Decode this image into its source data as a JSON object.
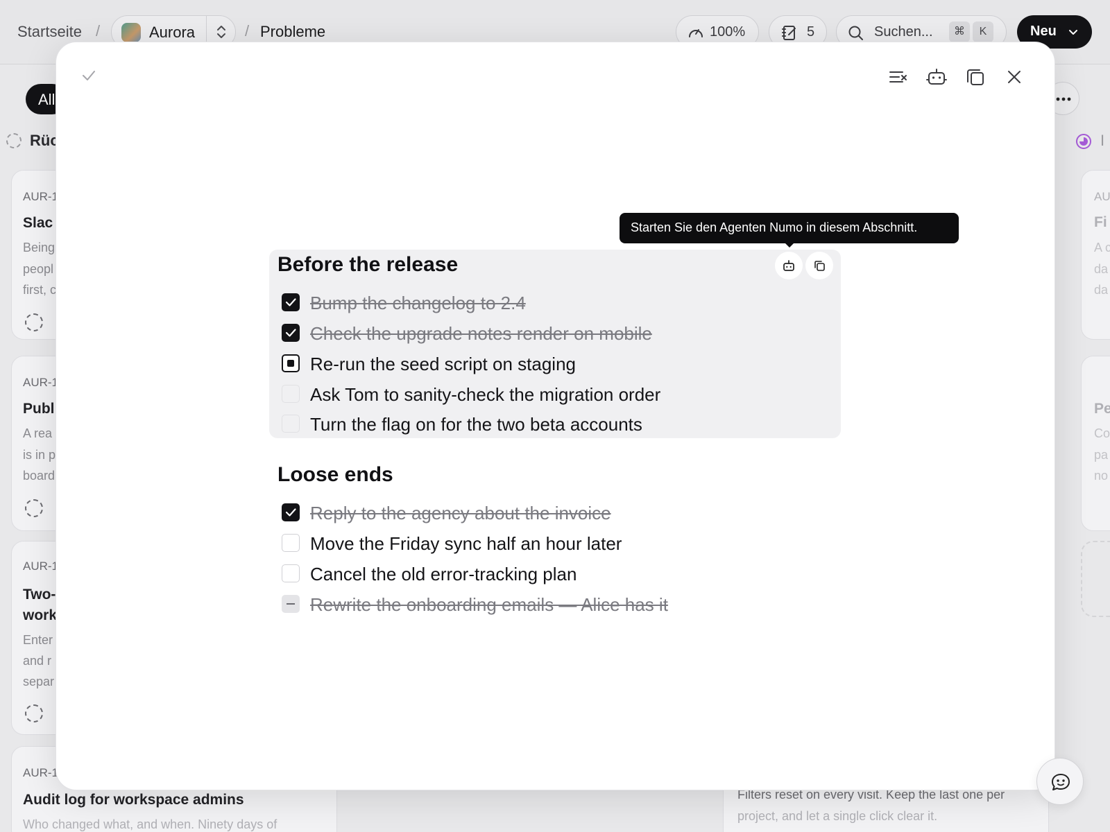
{
  "breadcrumb": {
    "home": "Startseite",
    "project": "Aurora",
    "page": "Probleme"
  },
  "header": {
    "zoom": "100%",
    "notes_count": "5",
    "search_placeholder": "Suchen...",
    "search_kbd_mod": "⌘",
    "search_kbd_key": "K",
    "new_label": "Neu"
  },
  "board": {
    "filter_all": "All",
    "column_title": "Rüc",
    "cards": [
      {
        "id": "AUR-1",
        "title": "Slac",
        "desc": [
          "Being",
          "peopl",
          "first, c"
        ]
      },
      {
        "id": "AUR-1",
        "title": "Publ",
        "desc": [
          "A rea",
          "is in p",
          "board"
        ]
      },
      {
        "id": "AUR-1",
        "title": "Two-",
        "title2": "work",
        "desc": [
          "Enter",
          "and r",
          "separ"
        ]
      },
      {
        "id": "AUR-1",
        "title": "Audit log for workspace admins",
        "desc": [
          "Who changed what, and when. Ninety days of"
        ]
      }
    ],
    "right_cards": [
      {
        "id": "AU",
        "title": "Fi",
        "desc": [
          "A c",
          "da",
          "da"
        ]
      },
      {
        "id": "",
        "title": "Pe",
        "desc": [
          "Co",
          "pa",
          "no"
        ]
      }
    ],
    "right_column_title": "I",
    "bottom_right_text": [
      "Filters reset on every visit. Keep the last one per",
      "project, and let a single click clear it."
    ]
  },
  "modal": {
    "tooltip": "Starten Sie den Agenten Numo in diesem Abschnitt.",
    "sections": [
      {
        "title": "Before the release",
        "items": [
          {
            "text": "Bump the changelog to 2.4",
            "state": "checked"
          },
          {
            "text": "Check the upgrade notes render on mobile",
            "state": "checked"
          },
          {
            "text": "Re-run the seed script on staging",
            "state": "current"
          },
          {
            "text": "Ask Tom to sanity-check the migration order",
            "state": "open"
          },
          {
            "text": "Turn the flag on for the two beta accounts",
            "state": "open"
          }
        ]
      },
      {
        "title": "Loose ends",
        "items": [
          {
            "text": "Reply to the agency about the invoice",
            "state": "checked"
          },
          {
            "text": "Move the Friday sync half an hour later",
            "state": "open"
          },
          {
            "text": "Cancel the old error-tracking plan",
            "state": "open"
          },
          {
            "text": "Rewrite the onboarding emails — Alice has it",
            "state": "cancelled"
          }
        ]
      }
    ]
  },
  "colors": {
    "accent": "#131316",
    "status_purple": "#a55bd6"
  }
}
